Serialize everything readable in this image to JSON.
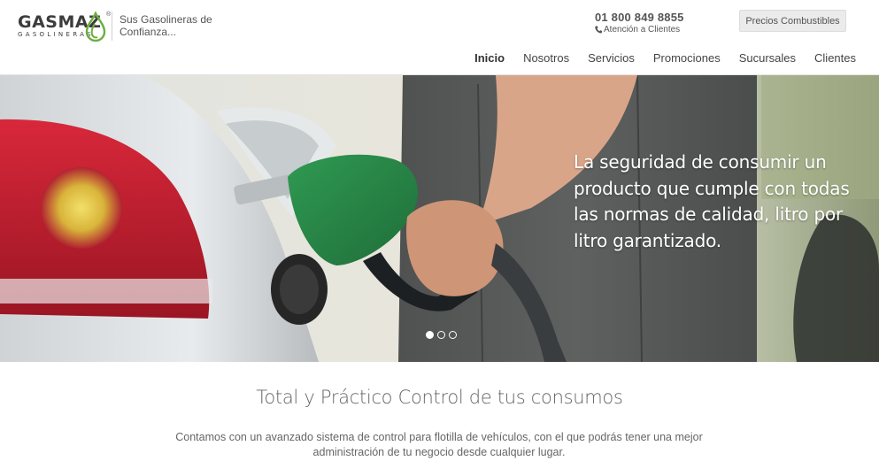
{
  "header": {
    "logo_text": "GASMAZ",
    "logo_subtext": "GASOLINERAS",
    "logo_reg": "®",
    "tagline": "Sus Gasolineras de Confianza...",
    "phone": "01 800 849 8855",
    "attention": "Atención a Clientes",
    "prices_button": "Precios Combustibles"
  },
  "nav": {
    "items": [
      {
        "label": "Inicio",
        "active": true
      },
      {
        "label": "Nosotros",
        "active": false
      },
      {
        "label": "Servicios",
        "active": false
      },
      {
        "label": "Promociones",
        "active": false
      },
      {
        "label": "Sucursales",
        "active": false
      },
      {
        "label": "Clientes",
        "active": false
      }
    ]
  },
  "hero": {
    "text": "La seguridad de consumir un producto que cumple con todas las normas de calidad, litro por litro garantizado.",
    "slides": 3,
    "active_slide": 1
  },
  "content": {
    "title": "Total y Práctico Control de tus consumos",
    "text": "Contamos con un avanzado sistema de control para flotilla de vehículos, con el que podrás tener una mejor administración de tu negocio desde cualquier lugar."
  },
  "colors": {
    "brand_green": "#6cae3f",
    "nozzle_green": "#2e8a4a"
  },
  "icons": [
    "gasmaz-drop-logo",
    "phone-icon"
  ]
}
